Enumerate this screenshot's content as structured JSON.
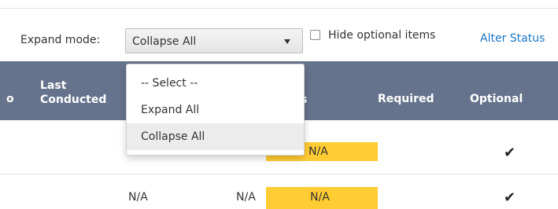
{
  "toolbar": {
    "expand_label": "Expand mode:",
    "expand_value": "Collapse All",
    "hide_optional_label": "Hide optional items",
    "hide_optional_checked": false,
    "alter_status_label": "Alter Status"
  },
  "dropdown": {
    "options": [
      "-- Select --",
      "Expand All",
      "Collapse All"
    ],
    "selected": "Collapse All"
  },
  "table": {
    "headers": {
      "cut_fragment": "o",
      "last_conducted_line1": "Last",
      "last_conducted_line2": "Conducted",
      "status_fragment": "s",
      "required": "Required",
      "optional": "Optional"
    },
    "rows": [
      {
        "last_conducted": "",
        "col_before_status": "",
        "status": "N/A",
        "required": "",
        "optional": "✔"
      },
      {
        "last_conducted": "N/A",
        "col_before_status": "N/A",
        "status": "N/A",
        "required": "",
        "optional": "✔"
      }
    ]
  },
  "colors": {
    "header_bg": "#66738c",
    "status_na": "#ffcc33",
    "link": "#1a76c7"
  }
}
